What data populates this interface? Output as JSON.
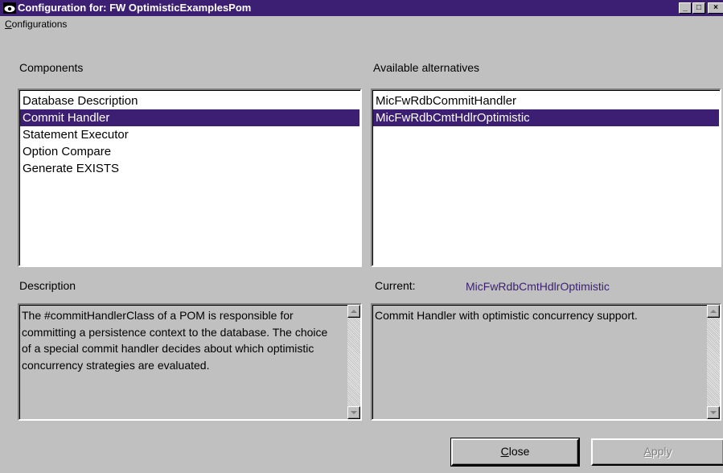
{
  "window": {
    "title": "Configuration for: FW OptimisticExamplesPom",
    "controls": {
      "minimize_glyph": "_",
      "maximize_glyph": "□",
      "close_glyph": "×"
    },
    "icon": "eye-icon"
  },
  "menu": {
    "configurations": {
      "label_accel": "C",
      "label_rest": "onfigurations"
    }
  },
  "components": {
    "heading": "Components",
    "items": [
      {
        "label": "Database Description",
        "selected": false
      },
      {
        "label": "Commit Handler",
        "selected": true
      },
      {
        "label": "Statement Executor",
        "selected": false
      },
      {
        "label": "Option Compare",
        "selected": false
      },
      {
        "label": "Generate EXISTS",
        "selected": false
      }
    ]
  },
  "alternatives": {
    "heading": "Available alternatives",
    "items": [
      {
        "label": "MicFwRdbCommitHandler",
        "selected": false
      },
      {
        "label": "MicFwRdbCmtHdlrOptimistic",
        "selected": true
      }
    ]
  },
  "description": {
    "heading": "Description",
    "text": "The #commitHandlerClass of a POM is responsible for committing a persistence context to the database. The choice of a special commit handler decides about which optimistic concurrency strategies are evaluated."
  },
  "current": {
    "label": "Current:",
    "value": "MicFwRdbCmtHdlrOptimistic",
    "text": "Commit Handler with optimistic concurrency support."
  },
  "buttons": {
    "close": {
      "accel": "C",
      "rest": "lose"
    },
    "apply": {
      "accel": "A",
      "rest": "pply",
      "enabled": false
    }
  },
  "colors": {
    "accent": "#3c1f72",
    "face": "#c0c0c0"
  }
}
